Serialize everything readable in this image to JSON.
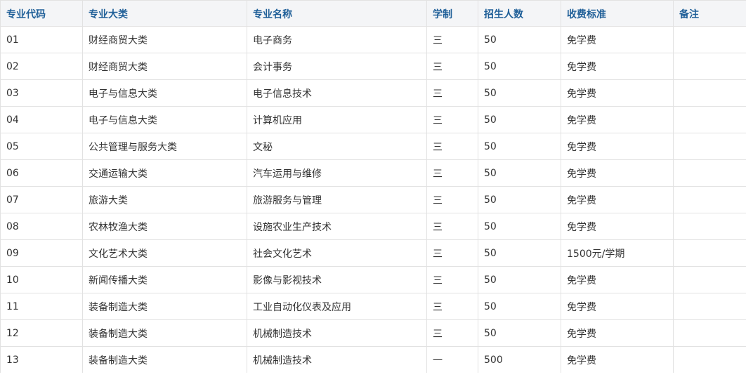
{
  "table": {
    "headers": [
      "专业代码",
      "专业大类",
      "专业名称",
      "学制",
      "招生人数",
      "收费标准",
      "备注"
    ],
    "rows": [
      [
        "01",
        "财经商贸大类",
        "电子商务",
        "三",
        "50",
        "免学费",
        ""
      ],
      [
        "02",
        "财经商贸大类",
        "会计事务",
        "三",
        "50",
        "免学费",
        ""
      ],
      [
        "03",
        "电子与信息大类",
        "电子信息技术",
        "三",
        "50",
        "免学费",
        ""
      ],
      [
        "04",
        "电子与信息大类",
        "计算机应用",
        "三",
        "50",
        "免学费",
        ""
      ],
      [
        "05",
        "公共管理与服务大类",
        "文秘",
        "三",
        "50",
        "免学费",
        ""
      ],
      [
        "06",
        "交通运输大类",
        "汽车运用与维修",
        "三",
        "50",
        "免学费",
        ""
      ],
      [
        "07",
        "旅游大类",
        "旅游服务与管理",
        "三",
        "50",
        "免学费",
        ""
      ],
      [
        "08",
        "农林牧渔大类",
        "设施农业生产技术",
        "三",
        "50",
        "免学费",
        ""
      ],
      [
        "09",
        "文化艺术大类",
        "社会文化艺术",
        "三",
        "50",
        "1500元/学期",
        ""
      ],
      [
        "10",
        "新闻传播大类",
        "影像与影视技术",
        "三",
        "50",
        "免学费",
        ""
      ],
      [
        "11",
        "装备制造大类",
        "工业自动化仪表及应用",
        "三",
        "50",
        "免学费",
        ""
      ],
      [
        "12",
        "装备制造大类",
        "机械制造技术",
        "三",
        "50",
        "免学费",
        ""
      ],
      [
        "13",
        "装备制造大类",
        "机械制造技术",
        "一",
        "500",
        "免学费",
        ""
      ]
    ]
  },
  "colors": {
    "header_text": "#1f5f98",
    "header_bg": "#f4f5f7",
    "border": "#e2e2e2",
    "body_text": "#333333"
  }
}
